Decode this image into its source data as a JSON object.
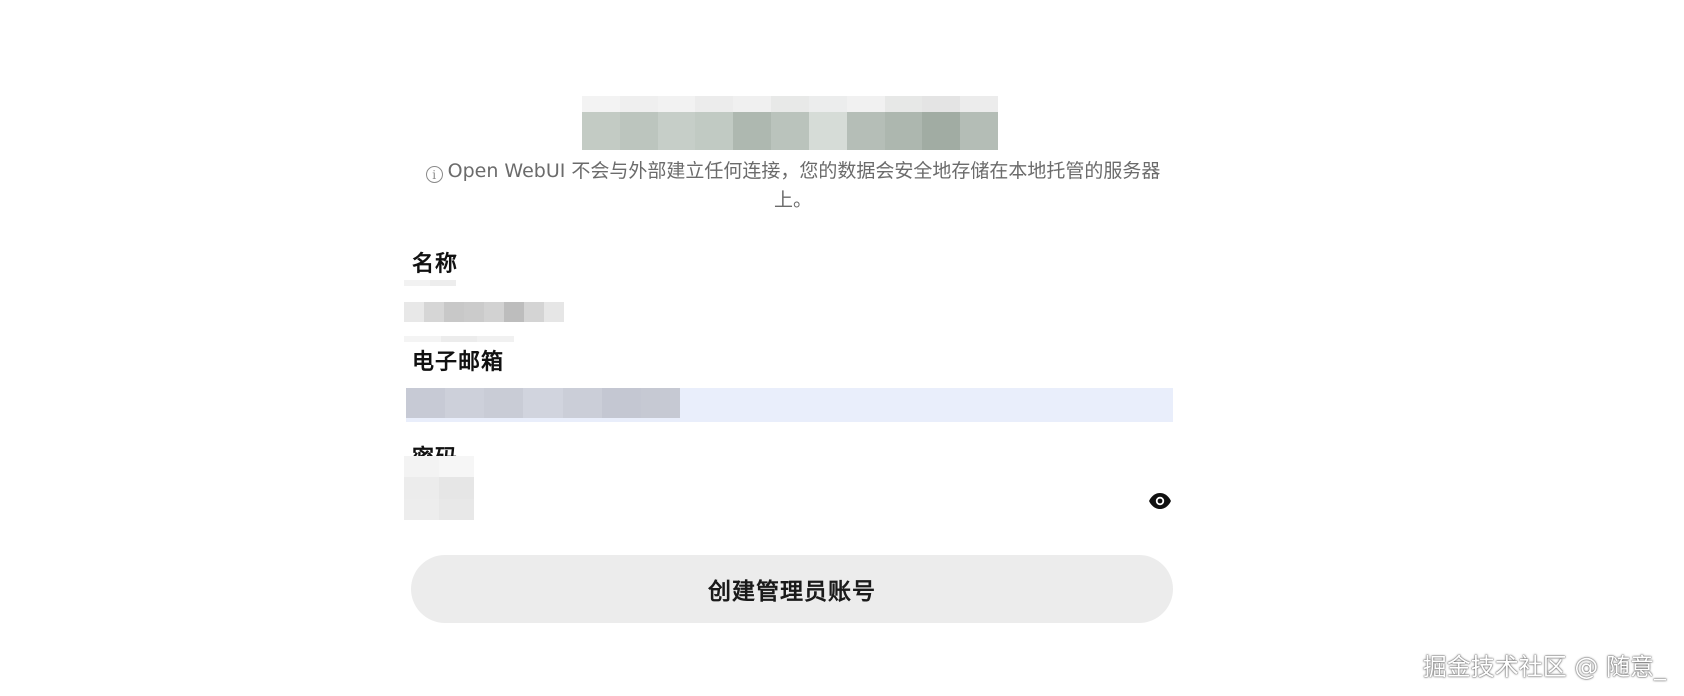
{
  "notice": {
    "icon": "info-circle-icon",
    "text": "Open WebUI 不会与外部建立任何连接，您的数据会安全地存储在本地托管的服务器上。"
  },
  "form": {
    "name_label": "名称",
    "email_label": "电子邮箱",
    "password_label": "密码",
    "password_toggle_icon": "eye-icon",
    "submit_label": "创建管理员账号"
  },
  "watermark": "掘金技术社区 @ 随意_",
  "colors": {
    "email_field_bg": "#e9eefb",
    "button_bg": "#ececec",
    "notice_text": "#6b6b6b"
  }
}
